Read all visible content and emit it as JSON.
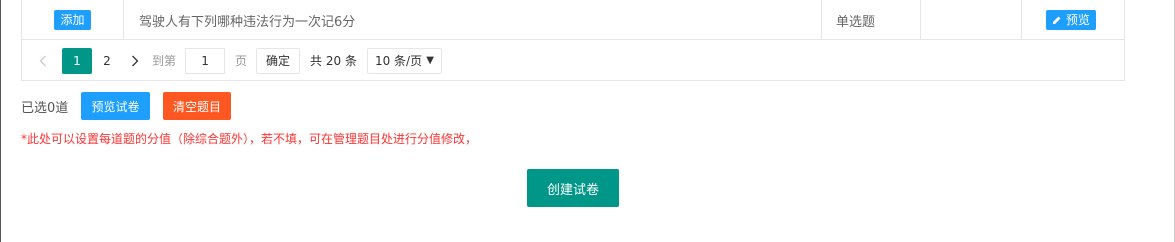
{
  "table": {
    "row": {
      "add_label": "添加",
      "question": "驾驶人有下列哪种违法行为一次记6分",
      "type": "单选题",
      "score": "",
      "preview_label": "预览"
    }
  },
  "pager": {
    "pages": [
      "1",
      "2"
    ],
    "current_page": "1",
    "goto_label": "到第",
    "goto_value": "1",
    "page_unit": "页",
    "confirm_label": "确定",
    "total_label": "共 20 条",
    "page_size": "10 条/页",
    "active_color": "#009688"
  },
  "selection": {
    "selected_text": "已选0道",
    "preview_paper_label": "预览试卷",
    "clear_label": "清空题目"
  },
  "note": "*此处可以设置每道题的分值（除综合题外），若不填，可在管理题目处进行分值修改，",
  "create_label": "创建试卷",
  "colors": {
    "primary": "#009688",
    "blue": "#1e9fff",
    "danger": "#ff5722",
    "note_red": "#ff3333"
  },
  "icons": [
    "chevron-left-icon",
    "chevron-right-icon",
    "edit-icon",
    "dropdown-caret-icon"
  ]
}
